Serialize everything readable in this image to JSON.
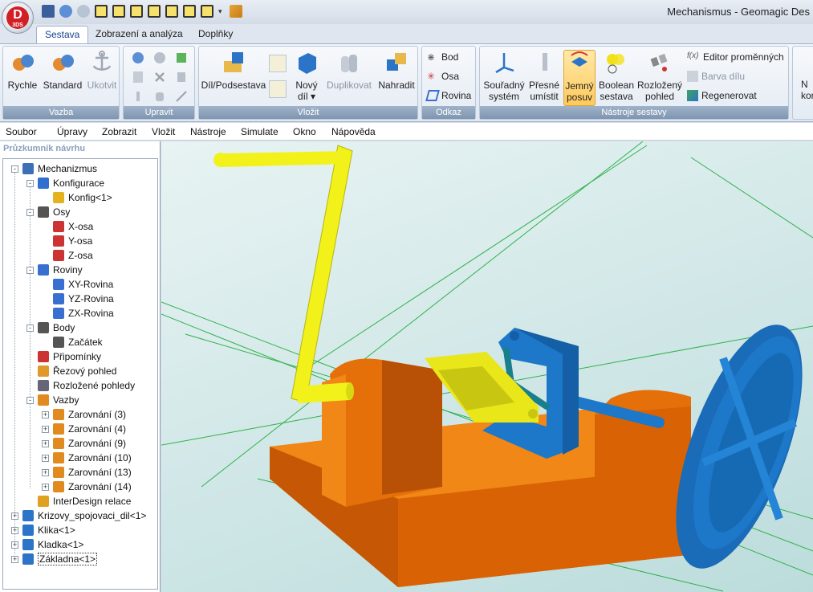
{
  "window": {
    "title": "Mechanismus - Geomagic Des"
  },
  "app_logo": {
    "letter": "D",
    "sub": "3DS"
  },
  "tabs": [
    {
      "label": "Sestava",
      "active": true
    },
    {
      "label": "Zobrazení a analýza",
      "active": false
    },
    {
      "label": "Doplňky",
      "active": false
    }
  ],
  "ribbon": {
    "vazba": {
      "label": "Vazba",
      "rychle": "Rychle",
      "standard": "Standard",
      "ukotvit": "Ukotvit"
    },
    "upravit": {
      "label": "Upravit"
    },
    "vlozit": {
      "label": "Vložit",
      "dil_podsestava": "Díl/Podsestava",
      "novy_dil_1": "Nový",
      "novy_dil_2": "díl",
      "duplikovat": "Duplikovat",
      "nahradit": "Nahradit"
    },
    "odkaz": {
      "label": "Odkaz",
      "bod": "Bod",
      "osa": "Osa",
      "rovina": "Rovina"
    },
    "nastroje": {
      "label": "Nástroje sestavy",
      "souradny_1": "Souřadný",
      "souradny_2": "systém",
      "presne_1": "Přesné",
      "presne_2": "umístit",
      "jemny_1": "Jemný",
      "jemny_2": "posuv",
      "boolean_1": "Boolean",
      "boolean_2": "sestava",
      "rozlozeny_1": "Rozložený",
      "rozlozeny_2": "pohled",
      "editor": "Editor proměnných",
      "barva": "Barva dílu",
      "regenerovat": "Regenerovat",
      "fx": "f(x)"
    },
    "extra": {
      "line1": "N",
      "line2": "kont"
    }
  },
  "menu": [
    "Soubor",
    "Úpravy",
    "Zobrazit",
    "Vložit",
    "Nástroje",
    "Simulate",
    "Okno",
    "Nápověda"
  ],
  "panel": {
    "title": "Průzkumník návrhu"
  },
  "tree": [
    {
      "label": "Mechanizmus",
      "level": 0,
      "exp": "-",
      "icon": "assembly-icon",
      "color": "#3d6fb6"
    },
    {
      "label": "Konfigurace",
      "level": 1,
      "exp": "-",
      "icon": "config-icon",
      "color": "#2e6fd0"
    },
    {
      "label": "Konfig<1>",
      "level": 2,
      "exp": "",
      "icon": "config-icon",
      "color": "#e4b21e"
    },
    {
      "label": "Osy",
      "level": 1,
      "exp": "-",
      "icon": "axes-icon",
      "color": "#555"
    },
    {
      "label": "X-osa",
      "level": 2,
      "exp": "",
      "icon": "axis-icon",
      "color": "#c33"
    },
    {
      "label": "Y-osa",
      "level": 2,
      "exp": "",
      "icon": "axis-icon",
      "color": "#c33"
    },
    {
      "label": "Z-osa",
      "level": 2,
      "exp": "",
      "icon": "axis-icon",
      "color": "#c33"
    },
    {
      "label": "Roviny",
      "level": 1,
      "exp": "-",
      "icon": "planes-icon",
      "color": "#3a6fd2"
    },
    {
      "label": "XY-Rovina",
      "level": 2,
      "exp": "",
      "icon": "plane-icon",
      "color": "#3a6fd2"
    },
    {
      "label": "YZ-Rovina",
      "level": 2,
      "exp": "",
      "icon": "plane-icon",
      "color": "#3a6fd2"
    },
    {
      "label": "ZX-Rovina",
      "level": 2,
      "exp": "",
      "icon": "plane-icon",
      "color": "#3a6fd2"
    },
    {
      "label": "Body",
      "level": 1,
      "exp": "-",
      "icon": "points-icon",
      "color": "#555"
    },
    {
      "label": "Začátek",
      "level": 2,
      "exp": "",
      "icon": "point-icon",
      "color": "#555"
    },
    {
      "label": "Připomínky",
      "level": 1,
      "exp": "",
      "icon": "notes-icon",
      "color": "#c33"
    },
    {
      "label": "Řezový pohled",
      "level": 1,
      "exp": "",
      "icon": "section-view-icon",
      "color": "#e09a2a"
    },
    {
      "label": "Rozložené pohledy",
      "level": 1,
      "exp": "",
      "icon": "exploded-view-icon",
      "color": "#667"
    },
    {
      "label": "Vazby",
      "level": 1,
      "exp": "-",
      "icon": "constraints-icon",
      "color": "#e08a20"
    },
    {
      "label": "Zarovnání (3)",
      "level": 2,
      "exp": "+",
      "icon": "align-icon",
      "color": "#e08a20"
    },
    {
      "label": "Zarovnání (4)",
      "level": 2,
      "exp": "+",
      "icon": "align-icon",
      "color": "#e08a20"
    },
    {
      "label": "Zarovnání (9)",
      "level": 2,
      "exp": "+",
      "icon": "align-icon",
      "color": "#e08a20"
    },
    {
      "label": "Zarovnání (10)",
      "level": 2,
      "exp": "+",
      "icon": "align-icon",
      "color": "#e08a20"
    },
    {
      "label": "Zarovnání (13)",
      "level": 2,
      "exp": "+",
      "icon": "align-icon",
      "color": "#e08a20"
    },
    {
      "label": "Zarovnání (14)",
      "level": 2,
      "exp": "+",
      "icon": "align-icon",
      "color": "#e08a20"
    },
    {
      "label": "InterDesign relace",
      "level": 1,
      "exp": "",
      "icon": "interdesign-icon",
      "color": "#e0a020"
    },
    {
      "label": "Krizovy_spojovaci_dil<1>",
      "level": 0,
      "exp": "+",
      "icon": "part-icon",
      "color": "#2b74c7"
    },
    {
      "label": "Klika<1>",
      "level": 0,
      "exp": "+",
      "icon": "part-icon",
      "color": "#2b74c7"
    },
    {
      "label": "Kladka<1>",
      "level": 0,
      "exp": "+",
      "icon": "part-icon",
      "color": "#2b74c7"
    },
    {
      "label": "Základna<1>",
      "level": 0,
      "exp": "+",
      "icon": "part-icon",
      "color": "#2b74c7",
      "selected": true
    }
  ],
  "model_colors": {
    "crank": "#f2f21a",
    "base": "#f07b0c",
    "wheel": "#1d78c9",
    "link": "#1a7f8c"
  }
}
